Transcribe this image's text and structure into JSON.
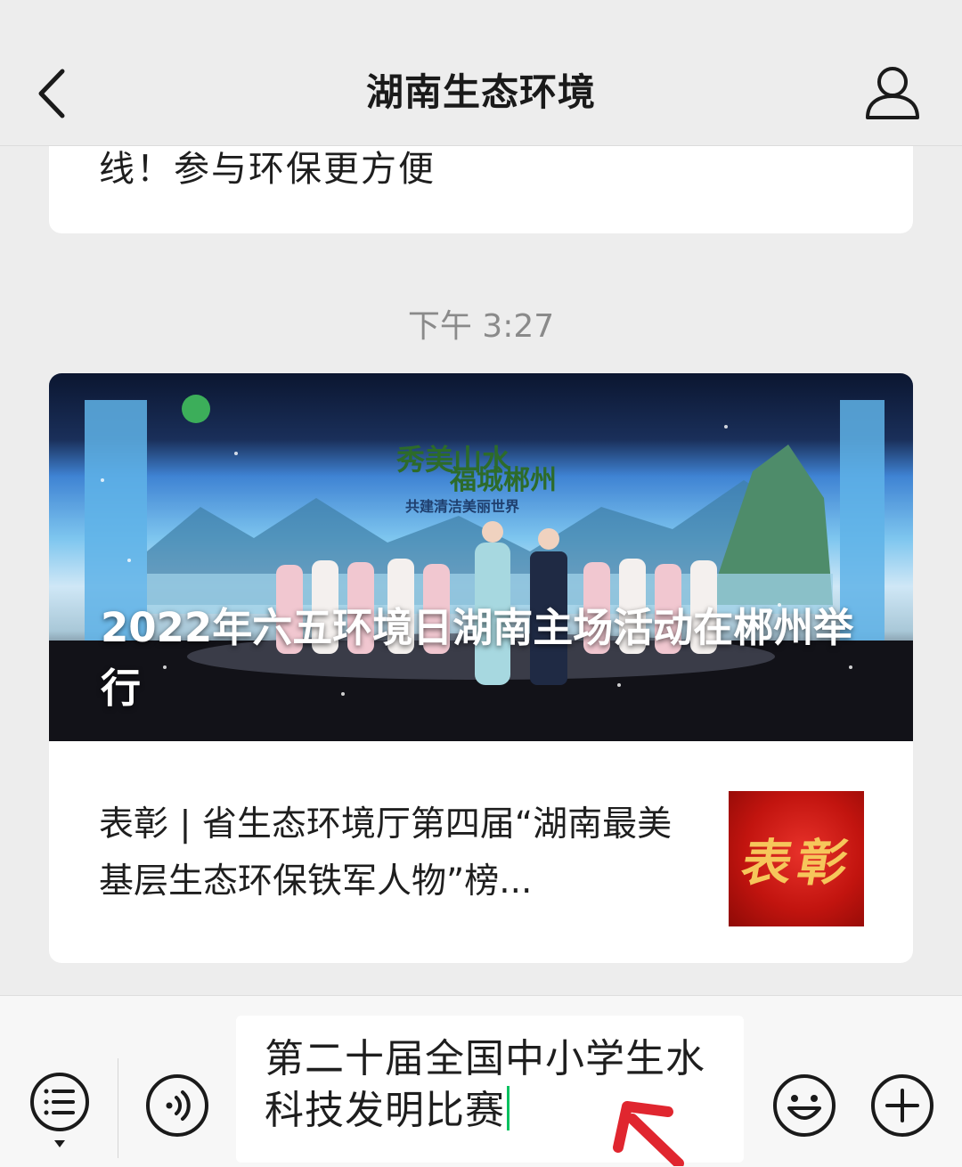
{
  "header": {
    "title": "湖南生态环境",
    "back_icon": "chevron-left-icon",
    "profile_icon": "person-icon"
  },
  "previous_message": {
    "text_fragment": "线！参与环保更方便"
  },
  "timestamp": "下午 3:27",
  "article_card": {
    "cover": {
      "title": "2022年六五环境日湖南主场活动在郴州举行",
      "stage_banner_text": [
        "秀美山水",
        "福城郴州",
        "共建清洁美丽世界"
      ]
    },
    "item2": {
      "title": "表彰 | 省生态环境厅第四届“湖南最美基层生态环保铁军人物”榜...",
      "thumbnail_text": "表彰"
    }
  },
  "bottom_bar": {
    "menu_icon": "menu-list-icon",
    "voice_icon": "voice-icon",
    "input_value": "第二十届全国中小学生水科技发明比赛",
    "emoji_icon": "emoji-icon",
    "plus_icon": "plus-icon"
  },
  "colors": {
    "background": "#ededed",
    "card": "#ffffff",
    "caret": "#07c160",
    "annotation_arrow": "#e0262f",
    "thumb_red": "#c2140f",
    "thumb_gold": "#f6c65b"
  }
}
